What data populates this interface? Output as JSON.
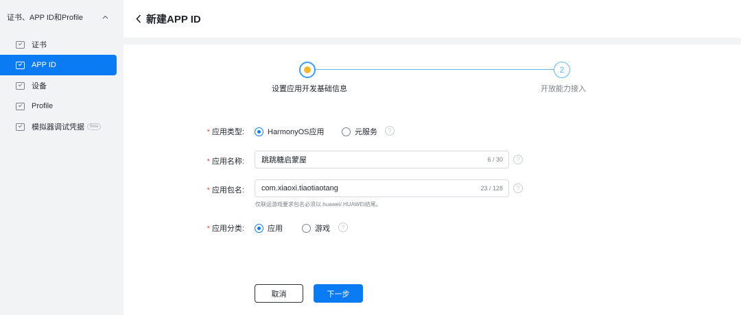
{
  "sidebar": {
    "group_label": "证书、APP ID和Profile",
    "items": [
      {
        "label": "证书"
      },
      {
        "label": "APP ID"
      },
      {
        "label": "设备"
      },
      {
        "label": "Profile"
      },
      {
        "label": "模拟器调试凭据",
        "badge": "Beta"
      }
    ],
    "active_index": 1
  },
  "header": {
    "title": "新建APP ID"
  },
  "steps": [
    {
      "label": "设置应用开发基础信息",
      "state": "current"
    },
    {
      "number": "2",
      "label": "开放能力接入",
      "state": "pending"
    }
  ],
  "form": {
    "app_type": {
      "label": "应用类型:",
      "options": [
        "HarmonyOS应用",
        "元服务"
      ],
      "selected": "HarmonyOS应用"
    },
    "app_name": {
      "label": "应用名称:",
      "value": "跳跳糖启蒙屋",
      "counter": "6 / 30"
    },
    "package_name": {
      "label": "应用包名:",
      "value": "com.xiaoxi.tiaotiaotang",
      "counter": "23 / 128",
      "hint": "仅联运游戏要求包名必须以.huawei/.HUAWEI结尾。"
    },
    "app_category": {
      "label": "应用分类:",
      "options": [
        "应用",
        "游戏"
      ],
      "selected": "应用"
    },
    "required_mark": "*",
    "help_glyph": "?"
  },
  "buttons": {
    "cancel": "取消",
    "next": "下一步"
  },
  "colors": {
    "primary": "#0a7bf2",
    "step_active": "#f5b72e",
    "required": "#e84a3c"
  }
}
